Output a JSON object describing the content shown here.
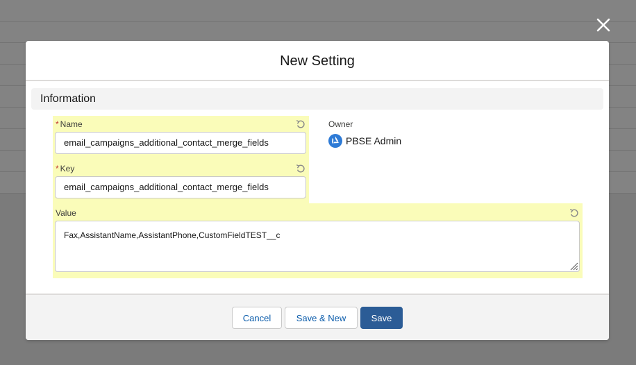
{
  "modal": {
    "title": "New Setting",
    "close_icon": "close-icon"
  },
  "section": {
    "title": "Information"
  },
  "fields": {
    "name": {
      "label": "Name",
      "required_marker": "*",
      "value": "email_campaigns_additional_contact_merge_fields"
    },
    "key": {
      "label": "Key",
      "required_marker": "*",
      "value": "email_campaigns_additional_contact_merge_fields"
    },
    "value": {
      "label": "Value",
      "value": "Fax,AssistantName,AssistantPhone,CustomFieldTEST__c"
    },
    "owner": {
      "label": "Owner",
      "name": "PBSE Admin",
      "icon": "owner-avatar-icon"
    }
  },
  "footer": {
    "cancel_label": "Cancel",
    "save_new_label": "Save & New",
    "save_label": "Save"
  },
  "colors": {
    "highlight": "#fafcb9",
    "brand": "#2b5c96",
    "link": "#0b5cab",
    "required": "#c23934",
    "overlay": "#7b7b7b"
  }
}
